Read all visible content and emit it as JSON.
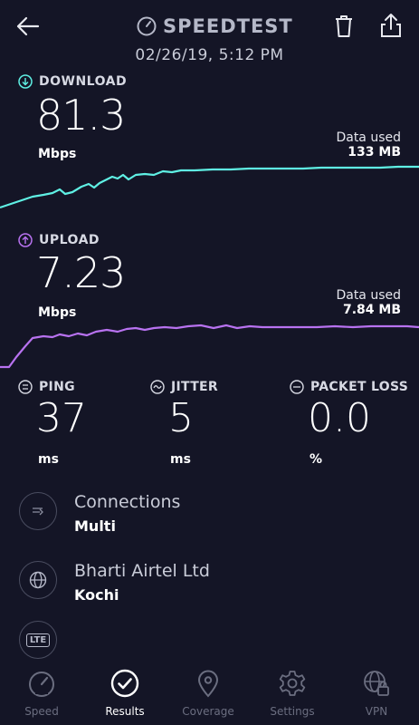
{
  "header": {
    "title": "SPEEDTEST",
    "datetime": "02/26/19, 5:12 PM"
  },
  "download": {
    "label": "DOWNLOAD",
    "value": "81.3",
    "unit": "Mbps",
    "data_used_label": "Data used",
    "data_used_value": "133 MB",
    "color": "#5ff0e4"
  },
  "upload": {
    "label": "UPLOAD",
    "value": "7.23",
    "unit": "Mbps",
    "data_used_label": "Data used",
    "data_used_value": "7.84 MB",
    "color": "#b872f0"
  },
  "stats": {
    "ping": {
      "label": "PING",
      "value": "37",
      "unit": "ms"
    },
    "jitter": {
      "label": "JITTER",
      "value": "5",
      "unit": "ms"
    },
    "packet_loss": {
      "label": "PACKET LOSS",
      "value": "0.0",
      "unit": "%"
    }
  },
  "info": {
    "connections": {
      "title": "Connections",
      "value": "Multi"
    },
    "provider": {
      "title": "Bharti Airtel Ltd",
      "value": "Kochi"
    },
    "network_badge": "LTE"
  },
  "nav": {
    "items": [
      {
        "label": "Speed",
        "icon": "speedometer-icon"
      },
      {
        "label": "Results",
        "icon": "check-circle-icon"
      },
      {
        "label": "Coverage",
        "icon": "map-pin-icon"
      },
      {
        "label": "Settings",
        "icon": "gear-icon"
      },
      {
        "label": "VPN",
        "icon": "vpn-globe-lock-icon"
      }
    ],
    "active": "Results"
  },
  "colors": {
    "background": "#141526",
    "muted": "#6b6e80"
  }
}
